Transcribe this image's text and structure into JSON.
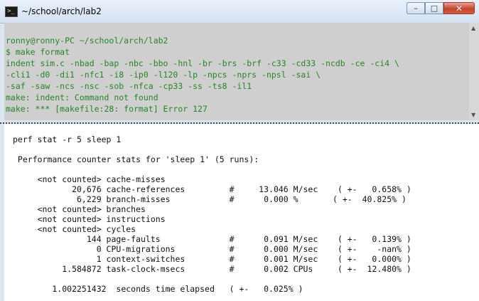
{
  "window": {
    "title": "~/school/arch/lab2",
    "app_icon_glyph": ">_",
    "controls": {
      "minimize": "–",
      "maximize": "□",
      "close": "✕"
    }
  },
  "scrollbar": {
    "up": "▲",
    "down": "▼"
  },
  "terminal": {
    "lines": [
      "ronny@ronny-PC ~/school/arch/lab2",
      "$ make format",
      "indent sim.c -nbad -bap -nbc -bbo -hnl -br -brs -brf -c33 -cd33 -ncdb -ce -ci4 \\",
      "-cli1 -d0 -di1 -nfc1 -i8 -ip0 -l120 -lp -npcs -nprs -npsl -sai \\",
      "-saf -saw -ncs -nsc -sob -nfca -cp33 -ss -ts8 -il1",
      "make: indent: Command not found",
      "make: *** [makefile:28: format] Error 127"
    ],
    "text_color": "#1f8a1f"
  },
  "perf": {
    "lines": [
      "perf stat -r 5 sleep 1",
      "",
      " Performance counter stats for 'sleep 1' (5 runs):",
      "",
      "     <not counted> cache-misses",
      "            20,676 cache-references         #     13.046 M/sec    ( +-   0.658% )",
      "             6,229 branch-misses            #      0.000 %       ( +-  40.825% )",
      "     <not counted> branches",
      "     <not counted> instructions",
      "     <not counted> cycles",
      "               144 page-faults              #      0.091 M/sec    ( +-   0.139% )",
      "                 0 CPU-migrations           #      0.000 M/sec    ( +-    -nan% )",
      "                 1 context-switches         #      0.001 M/sec    ( +-   0.000% )",
      "          1.584872 task-clock-msecs         #      0.002 CPUs     ( +-  12.480% )",
      "",
      "        1.002251432  seconds time elapsed   ( +-   0.025% )"
    ]
  }
}
